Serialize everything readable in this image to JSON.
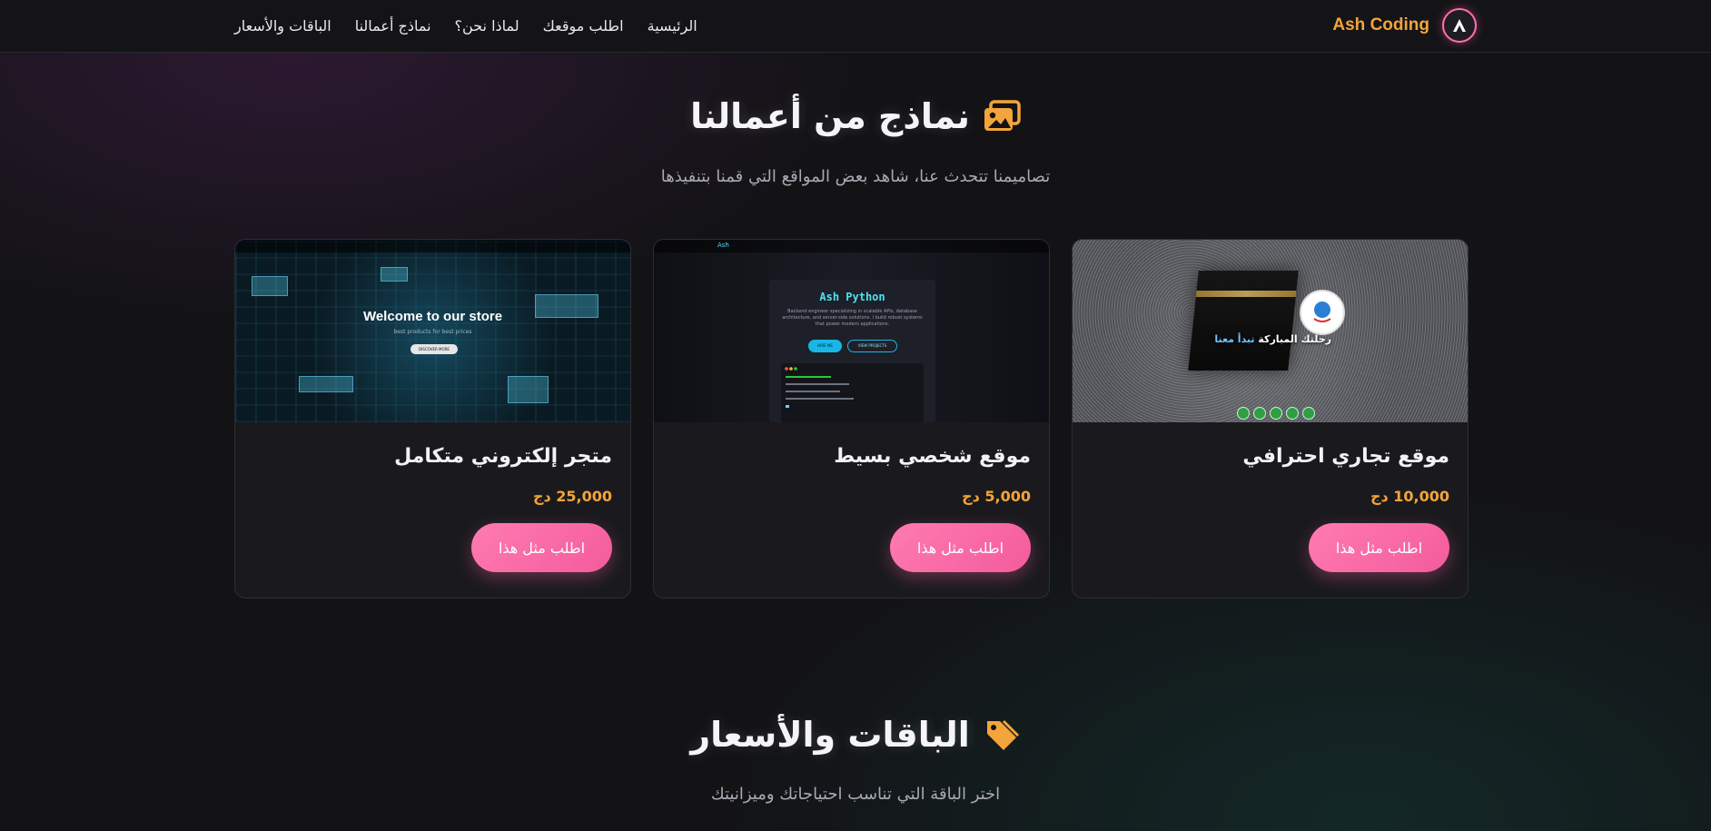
{
  "navbar": {
    "brand_name": "Ash Coding",
    "links": [
      "الرئيسية",
      "اطلب موقعك",
      "لماذا نحن؟",
      "نماذج أعمالنا",
      "الباقات والأسعار"
    ]
  },
  "portfolio": {
    "title": "نماذج من أعمالنا",
    "subtitle": "تصاميمنا تتحدث عنا، شاهد بعض المواقع التي قمنا بتنفيذها",
    "icon": "images-icon",
    "cards": [
      {
        "title": "موقع تجاري احترافي",
        "price": "10,000 دج",
        "button": "اطلب مثل هذا",
        "preview": {
          "headline_main": "رحلتك المباركة",
          "headline_accent": "تبدأ معنا"
        }
      },
      {
        "title": "موقع شخصي بسيط",
        "price": "5,000 دج",
        "button": "اطلب مثل هذا",
        "preview": {
          "logo_text": "Ash",
          "headline": "Ash Python",
          "description": "Backend engineer specializing in scalable APIs, database architecture, and server-side solutions. I build robust systems that power modern applications.",
          "btn_primary": "HIRE ME",
          "btn_secondary": "VIEW PROJECTS"
        }
      },
      {
        "title": "متجر إلكتروني متكامل",
        "price": "25,000 دج",
        "button": "اطلب مثل هذا",
        "preview": {
          "headline": "Welcome to our store",
          "sub": "best products for best prices",
          "button": "DISCOVER MORE"
        }
      }
    ]
  },
  "pricing": {
    "title": "الباقات والأسعار",
    "subtitle": "اختر الباقة التي تناسب احتياجاتك وميزانيتك",
    "icon": "tag-icon"
  },
  "colors": {
    "accent_orange": "#f3a43b",
    "accent_pink": "#f45b9c",
    "background": "#131316"
  }
}
